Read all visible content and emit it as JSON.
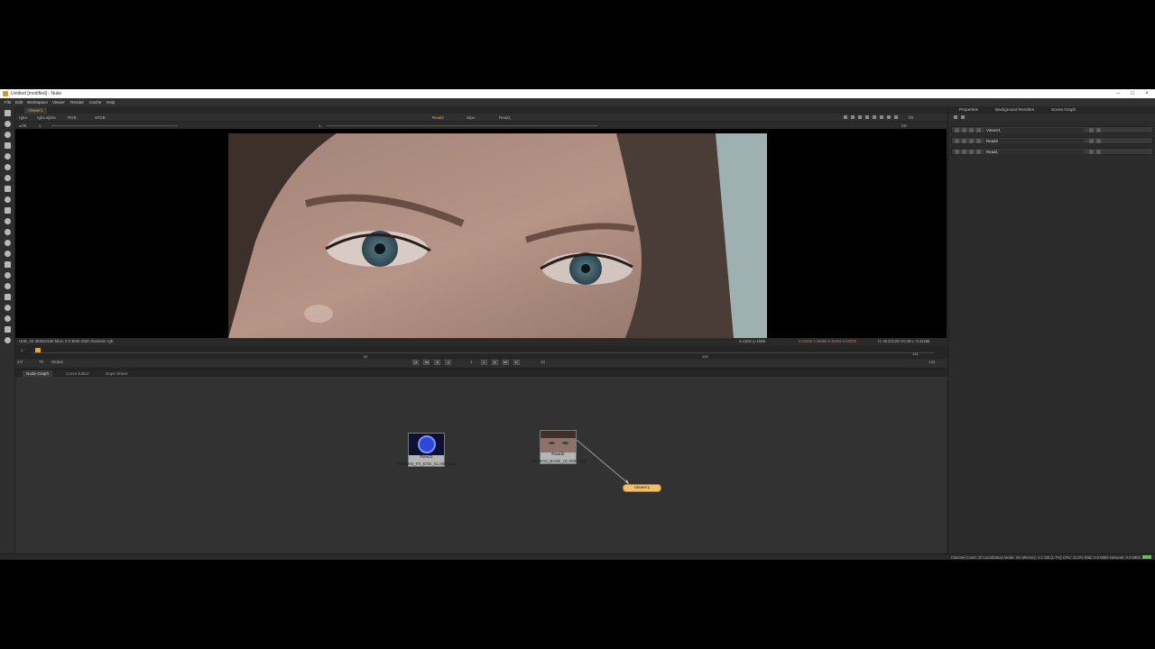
{
  "window": {
    "title": "Untitled [modified] - Nuke"
  },
  "menu": [
    "File",
    "Edit",
    "Workspace",
    "Viewer",
    "Render",
    "Cache",
    "Help"
  ],
  "viewer": {
    "tab": "Viewer1",
    "channels": "rgba",
    "layer": "rgba.alpha",
    "colorspace": "RGB",
    "view": "sRGB",
    "inputs": [
      "Read2",
      "Read1"
    ],
    "frame_label": "f/8",
    "gain": "1",
    "mode": "2D",
    "info_left": "UHD_4K 3840x2160  bbox: 0 0 3840 2160 channels: rgb",
    "coords": "x=1634 y=1568",
    "pixel": "0.41405 0.38685 0.35294 0.00000",
    "pixel_extra": "H: 15 S:0.20 V:0.49  L: 0.41265"
  },
  "timeline": {
    "start": "1",
    "end": "131",
    "fps": "24*",
    "tf": "TF",
    "range": "Global",
    "mark1": "50",
    "mark2": "100",
    "current": "1",
    "step": "10"
  },
  "nodegraph": {
    "tabs": [
      "Node Graph",
      "Curve Editor",
      "Dope Sheet"
    ],
    "nodes": [
      {
        "name": "Read1",
        "file": "WOMAN_FX_EYE_01.0001.dpx"
      },
      {
        "name": "Read2",
        "file": "WOMAN_BASE_01.0001.dpx"
      }
    ],
    "viewer_node": "Viewer1"
  },
  "properties": {
    "tabs": [
      "Properties",
      "Background Renders",
      "Scene Graph"
    ],
    "items": [
      "Viewer1",
      "Read2",
      "Read1"
    ]
  },
  "status": {
    "text": "Channel Count: 20  Localization Mode: On  Memory: 1.1 GB (1.7%)  CPU: 11.0%  Disk: 0.0 MB/s  Network: 0.0 MB/s"
  }
}
